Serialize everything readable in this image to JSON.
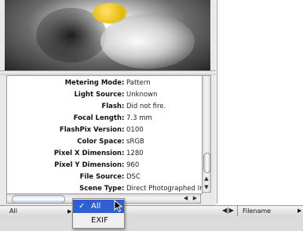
{
  "metadata": [
    {
      "key": "Metering Mode",
      "value": "Pattern"
    },
    {
      "key": "Light Source",
      "value": "Unknown"
    },
    {
      "key": "Flash",
      "value": "Did not fire."
    },
    {
      "key": "Focal Length",
      "value": "7.3 mm"
    },
    {
      "key": "FlashPix Version",
      "value": "0100"
    },
    {
      "key": "Color Space",
      "value": "sRGB"
    },
    {
      "key": "Pixel X Dimension",
      "value": "1280"
    },
    {
      "key": "Pixel Y Dimension",
      "value": "960"
    },
    {
      "key": "File Source",
      "value": "DSC"
    },
    {
      "key": "Scene Type",
      "value": "Direct Photographed Im"
    }
  ],
  "separator": ":",
  "view_select": {
    "selected": "All"
  },
  "popup_menu": {
    "items": [
      {
        "label": "All",
        "checked": true
      },
      {
        "label": "EXIF",
        "checked": false
      }
    ],
    "check_glyph": "✓"
  },
  "sort_select": {
    "label": "Filename"
  },
  "icons": {
    "vscroll_up": "▲",
    "vscroll_down": "▼",
    "hscroll_left": "◀",
    "hscroll_right": "▶",
    "dropdown": "▶",
    "column_divider": "◀|▶"
  },
  "colors": {
    "selection": "#2f5fd0"
  }
}
